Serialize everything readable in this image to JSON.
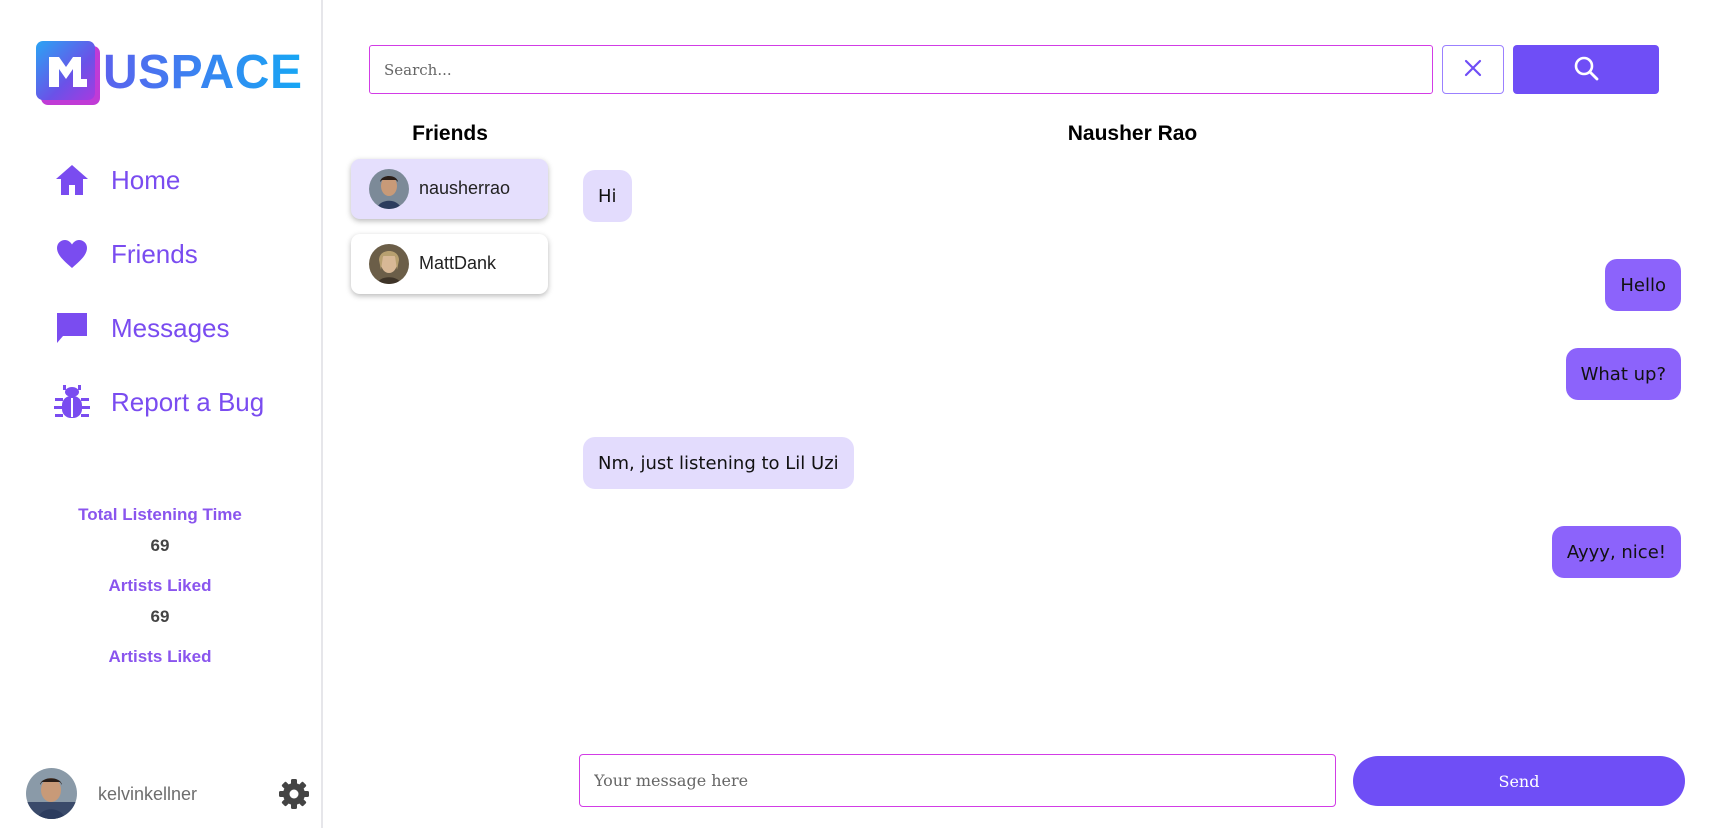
{
  "brand": {
    "name": "USPACE",
    "colors": {
      "accent": "#6f4ef6",
      "nav": "#7a4cf0",
      "input_border": "#d23ce6"
    }
  },
  "sidebar": {
    "items": [
      {
        "label": "Home",
        "icon": "home-icon"
      },
      {
        "label": "Friends",
        "icon": "heart-icon"
      },
      {
        "label": "Messages",
        "icon": "message-icon"
      },
      {
        "label": "Report a Bug",
        "icon": "bug-icon"
      }
    ],
    "stats": [
      {
        "label": "Total Listening Time",
        "value": "69"
      },
      {
        "label": "Artists Liked",
        "value": "69"
      },
      {
        "label": "Artists Liked"
      }
    ],
    "user": {
      "name": "kelvinkellner",
      "avatar_icon": "user-avatar",
      "settings_icon": "gear-icon"
    }
  },
  "search": {
    "placeholder": "Search...",
    "value": "",
    "clear_icon": "close-icon",
    "button_icon": "search-icon"
  },
  "friends": {
    "title": "Friends",
    "list": [
      {
        "name": "nausherrao",
        "active": true
      },
      {
        "name": "MattDank",
        "active": false
      }
    ]
  },
  "chat": {
    "title": "Nausher Rao",
    "messages": [
      {
        "text": "Hi",
        "from": "them"
      },
      {
        "text": "Hello",
        "from": "me"
      },
      {
        "text": "What up?",
        "from": "me"
      },
      {
        "text": "Nm, just listening to Lil Uzi",
        "from": "them"
      },
      {
        "text": "Ayyy, nice!",
        "from": "me"
      }
    ],
    "input": {
      "placeholder": "Your message here",
      "value": ""
    },
    "send_label": "Send"
  }
}
